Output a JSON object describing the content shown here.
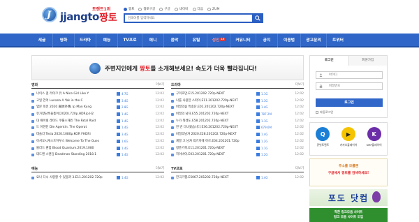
{
  "logo": {
    "text": "jjangto",
    "kr": "짱토",
    "tag": "토렌트1위"
  },
  "search": {
    "options": [
      {
        "label": "짱토",
        "selected": true
      },
      {
        "label": "짱토구글",
        "selected": false
      },
      {
        "label": "구글",
        "selected": false
      },
      {
        "label": "네이버",
        "selected": false
      },
      {
        "label": "다음",
        "selected": false
      },
      {
        "label": "ZUM",
        "selected": false
      }
    ],
    "placeholder": "검색어를 입력하세요"
  },
  "nav": [
    {
      "label": "새글",
      "w": 30
    },
    {
      "label": "영화",
      "w": 30
    },
    {
      "label": "드라마",
      "w": 30
    },
    {
      "label": "예능",
      "w": 30
    },
    {
      "label": "TV프로",
      "w": 34
    },
    {
      "label": "애니",
      "w": 30
    },
    {
      "label": "음악",
      "w": 30
    },
    {
      "label": "유틸",
      "w": 30
    },
    {
      "label": "성인",
      "w": 32,
      "badge": "19"
    },
    {
      "label": "커뮤니티",
      "w": 36
    },
    {
      "label": "공지",
      "w": 30
    },
    {
      "label": "이용법",
      "w": 32
    },
    {
      "label": "광고문의",
      "w": 36
    },
    {
      "label": "트위터",
      "w": 32
    }
  ],
  "banner": {
    "pre": "주변지인에게 ",
    "highlight": "짱토",
    "post": "를 소개해보세요! 속도가 더욱 빨라집니다!"
  },
  "movies": {
    "title": "영화",
    "more": "더보기",
    "rows": [
      {
        "title": "나이스 걸 라이크 유 A Nice Girl Like Y",
        "size": "4.7G",
        "time": "12:02"
      },
      {
        "title": "고일 언어 Lunana A Yak in the C",
        "size": "3.4G",
        "time": "12:02"
      },
      {
        "title": "엽문 외전 2020 眞帥外傳, Ip Man Kung",
        "size": "2.8G",
        "time": "12:02"
      },
      {
        "title": "유가향담록을총어(2020).720p.HDRip.H2",
        "size": "1.4G",
        "time": "12:02"
      },
      {
        "title": "대 패이럴 레이드 쿠룰스해킨 The Fatal Raid",
        "size": "1.4G",
        "time": "12:02"
      },
      {
        "title": "드 어젠틴 Die Agentin. The Operat",
        "size": "1.4G",
        "time": "12:02"
      },
      {
        "title": "테슬라 Tesla 2020.1080p.KOR FHDRi",
        "size": "3.4G",
        "time": "12:02"
      },
      {
        "title": "어서오시게스트하우스 Welcome To The Gues",
        "size": "1.6G",
        "time": "12:02"
      },
      {
        "title": "블러드 퀀텀 Blood Quantum.2019.1080",
        "size": "1.4G",
        "time": "12:02"
      },
      {
        "title": "데드맨 스탠딩 Deadman Standing 2018.1",
        "size": "1.4G",
        "time": "12:02"
      }
    ]
  },
  "dramas": {
    "title": "드라마",
    "more": "더보기",
    "rows": [
      {
        "title": "구미호뎐.E15.201202.720p-NEXT",
        "size": "1.1G",
        "time": "12:02"
      },
      {
        "title": "나를 사랑한 스파이.E11.201202.720p-NEXT",
        "size": "1.3G",
        "time": "12:02"
      },
      {
        "title": "비밀의숲 특송단.E01.201202.720p-NEXT",
        "size": "1.4G",
        "time": "12:02"
      },
      {
        "title": "비밀의 남자.E55.201202.720p-NEXT",
        "size": "787.2M",
        "time": "12:02"
      },
      {
        "title": "누가 뭐래도.E58.201202.720p-NEXT",
        "size": "1.1G",
        "time": "12:02"
      },
      {
        "title": "한 번 다녀왔습니다.E36.201202.720p-NEXT",
        "size": "679.6M",
        "time": "12:02"
      },
      {
        "title": "비밀의남자 2020.E28.201202.720p-NEXT",
        "size": "1.4G",
        "time": "12:02"
      },
      {
        "title": "계발 고 남자 외기지에 아르.E04.201201.720p",
        "size": "1.2G",
        "time": "12:02"
      },
      {
        "title": "청춘기록.E11.201201.720p-NEXT",
        "size": "1.1G",
        "time": "12:02"
      },
      {
        "title": "하이바이.E03.201201.720p-NEXT",
        "size": "1.2G",
        "time": "12:02"
      }
    ]
  },
  "variety": {
    "title": "예능",
    "more": "더보기",
    "rows": [
      {
        "title": "요나 다시 사랑할 수 있을까 3.E11.201202.720p",
        "size": "1.4G",
        "time": "12:02"
      }
    ]
  },
  "tvpro": {
    "title": "TV프로",
    "more": "더보기",
    "rows": [
      {
        "title": "한국기행.E5067.201202.720p-NEXT",
        "size": "1.4G",
        "time": "12:02"
      }
    ]
  },
  "login": {
    "tab_login": "로그인",
    "tab_join": "회원가입",
    "id_placeholder": "아이디",
    "pw_placeholder": "비밀번호",
    "button": "로그인",
    "auto": "자동로그인"
  },
  "apps": [
    {
      "label": "큐빗토렌트",
      "letter": "Q",
      "color": "#1b7fd6"
    },
    {
      "label": "카카오플레이어",
      "letter": "▶",
      "color": "#f5c400"
    },
    {
      "label": "KMP플레이어",
      "letter": "K",
      "color": "#6b2ea8"
    }
  ],
  "promo": {
    "line1": "주소를 모를땐",
    "line2": "구글에서 짱토를 검색하세요!"
  },
  "podo": {
    "text": "포도 닷컴"
  },
  "green_banner": {
    "line1": "착한 링크모음 사이트",
    "line2": "링크 모음 사이트 도입"
  }
}
